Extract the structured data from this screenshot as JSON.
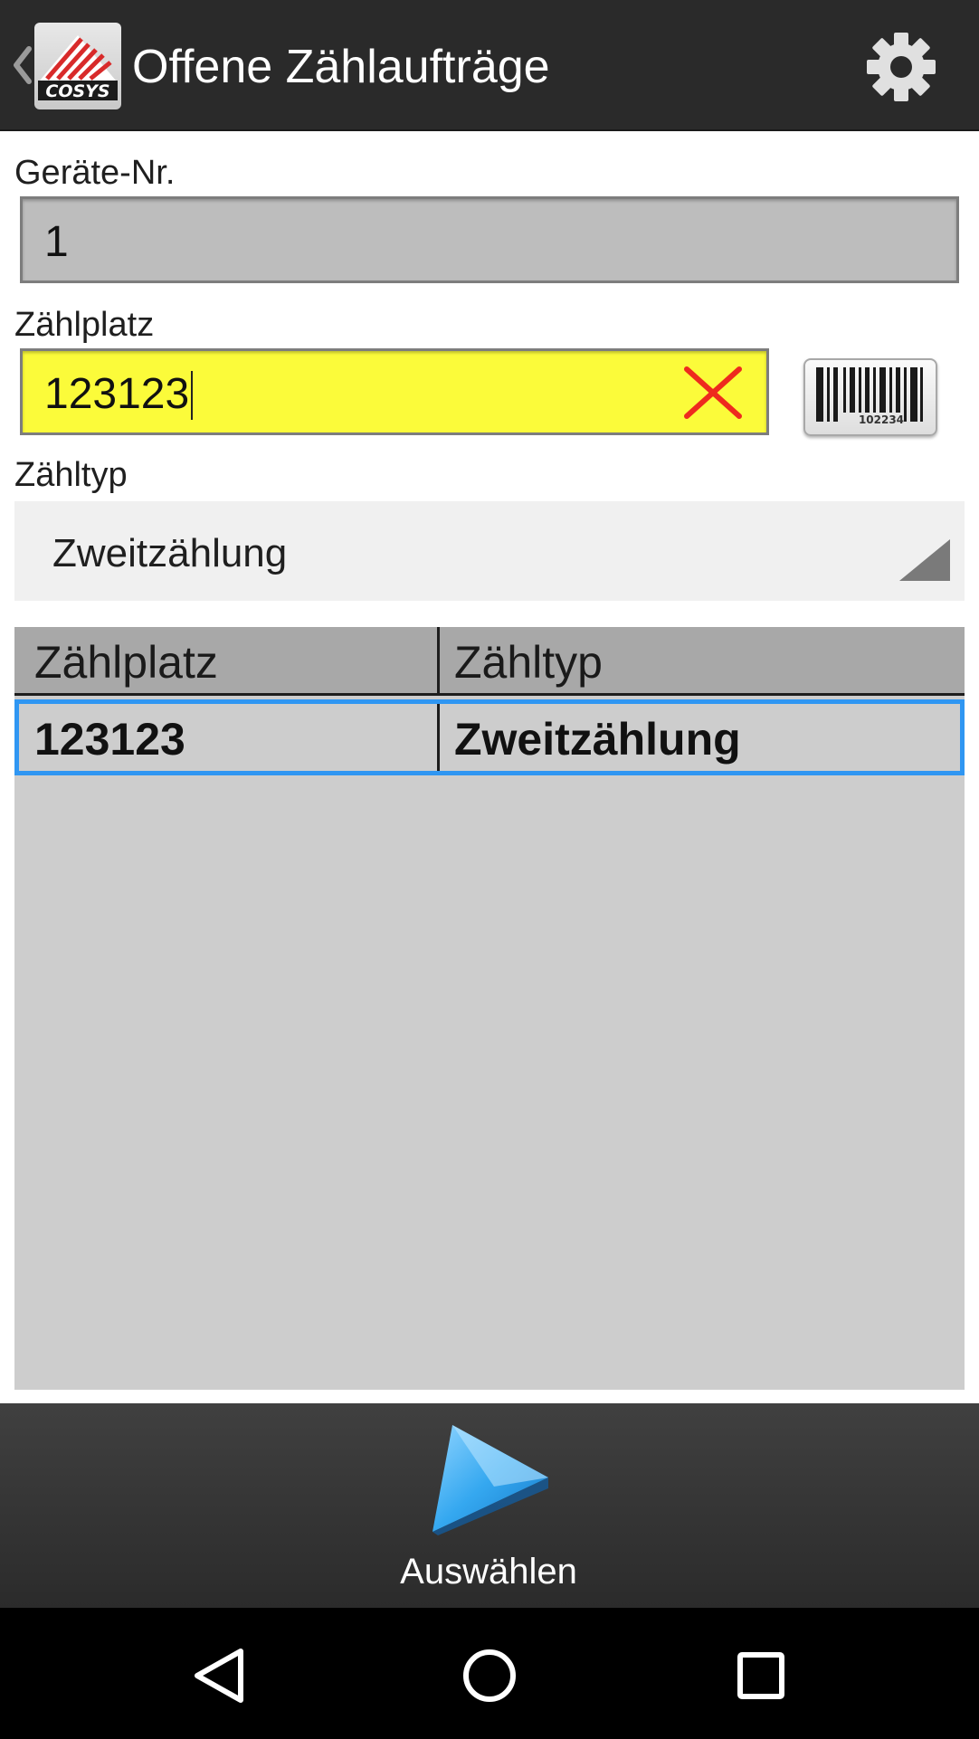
{
  "app_bar": {
    "title": "Offene Zählaufträge",
    "logo_text": "COSYS"
  },
  "form": {
    "geraet_label": "Geräte-Nr.",
    "geraet_value": "1",
    "zaehlplatz_label": "Zählplatz",
    "zaehlplatz_value": "123123",
    "zaehltyp_label": "Zähltyp",
    "zaehltyp_selected": "Zweitzählung",
    "barcode_number": "102234"
  },
  "table": {
    "headers": [
      "Zählplatz",
      "Zähltyp"
    ],
    "rows": [
      {
        "zaehlplatz": "123123",
        "zaehltyp": "Zweitzählung",
        "selected": true
      }
    ]
  },
  "bottom_bar": {
    "select_label": "Auswählen"
  },
  "colors": {
    "action_bar": "#2a2a2a",
    "input_active": "#fbfb3a",
    "selection_border": "#2f96f2",
    "clear_icon": "#ee2a1e"
  },
  "icons": [
    "back-caret-icon",
    "cosys-logo",
    "gear-icon",
    "clear-x-icon",
    "barcode-icon",
    "spinner-arrow-icon",
    "play-triangle-icon",
    "nav-back-icon",
    "nav-home-icon",
    "nav-recents-icon"
  ]
}
